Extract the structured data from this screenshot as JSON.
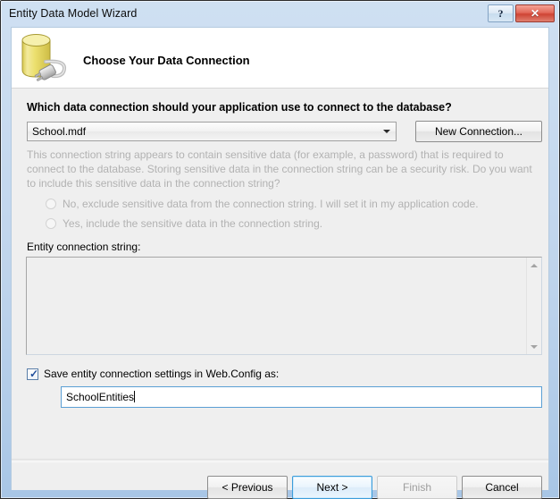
{
  "window": {
    "title": "Entity Data Model Wizard",
    "help_label": "?",
    "close_label": "✕",
    "icon_name": "database-connection-icon"
  },
  "header": {
    "title": "Choose Your Data Connection"
  },
  "main": {
    "question_label": "Which data connection should your application use to connect to the database?",
    "connection_combo": {
      "value": "School.mdf",
      "arrow_icon": "chevron-down-icon"
    },
    "new_connection_button": "New Connection...",
    "sensitive_data_text": "This connection string appears to contain sensitive data (for example, a password) that is required to connect to the database. Storing sensitive data in the connection string can be a security risk. Do you want to include this sensitive data in the connection string?",
    "radios": [
      {
        "label": "No, exclude sensitive data from the connection string. I will set it in my application code.",
        "selected": false,
        "disabled": true
      },
      {
        "label": "Yes, include the sensitive data in the connection string.",
        "selected": false,
        "disabled": true
      }
    ],
    "entity_connection_string_label": "Entity connection string:",
    "entity_connection_string_value": "",
    "scrollbar": {
      "up_icon": "triangle-up-icon",
      "down_icon": "triangle-down-icon"
    },
    "save_checkbox": {
      "label": "Save entity connection settings in Web.Config as:",
      "checked": true,
      "check_glyph": "✓"
    },
    "entity_name_input": {
      "value": "SchoolEntities",
      "placeholder": ""
    }
  },
  "footer": {
    "buttons": [
      {
        "label": "< Previous",
        "state": "normal"
      },
      {
        "label": "Next >",
        "state": "default"
      },
      {
        "label": "Finish",
        "state": "disabled"
      },
      {
        "label": "Cancel",
        "state": "normal"
      }
    ]
  },
  "colors": {
    "title_bar_top": "#cfe0f2",
    "title_bar_bottom": "#a8c6e6",
    "body_gray": "#efefef",
    "disabled_text": "#b2b2b2",
    "focus_blue": "#5b9fd4",
    "default_button_blue": "#3c9ddb",
    "close_red": "#cf4434",
    "icon_yellow": "#e8d96a"
  }
}
